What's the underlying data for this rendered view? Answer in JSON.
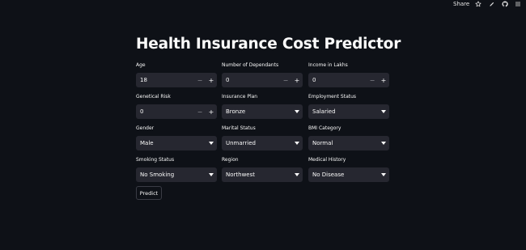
{
  "header": {
    "share_label": "Share",
    "icons": [
      "star-icon",
      "edit-icon",
      "github-icon",
      "menu-icon"
    ]
  },
  "page": {
    "title": "Health Insurance Cost Predictor"
  },
  "form": {
    "age": {
      "label": "Age",
      "value": "18"
    },
    "dependants": {
      "label": "Number of Dependants",
      "value": "0"
    },
    "income": {
      "label": "Income in Lakhs",
      "value": "0"
    },
    "genetical_risk": {
      "label": "Genetical Risk",
      "value": "0"
    },
    "insurance_plan": {
      "label": "Insurance Plan",
      "value": "Bronze"
    },
    "employment_status": {
      "label": "Employment Status",
      "value": "Salaried"
    },
    "gender": {
      "label": "Gender",
      "value": "Male"
    },
    "marital_status": {
      "label": "Marital Status",
      "value": "Unmarried"
    },
    "bmi_category": {
      "label": "BMI Category",
      "value": "Normal"
    },
    "smoking_status": {
      "label": "Smoking Status",
      "value": "No Smoking"
    },
    "region": {
      "label": "Region",
      "value": "Northwest"
    },
    "medical_history": {
      "label": "Medical History",
      "value": "No Disease"
    },
    "stepper_minus": "−",
    "stepper_plus": "+"
  },
  "actions": {
    "predict_label": "Predict"
  },
  "colors": {
    "background": "#0e1117",
    "input_bg": "#262730",
    "text": "#fafafa"
  }
}
